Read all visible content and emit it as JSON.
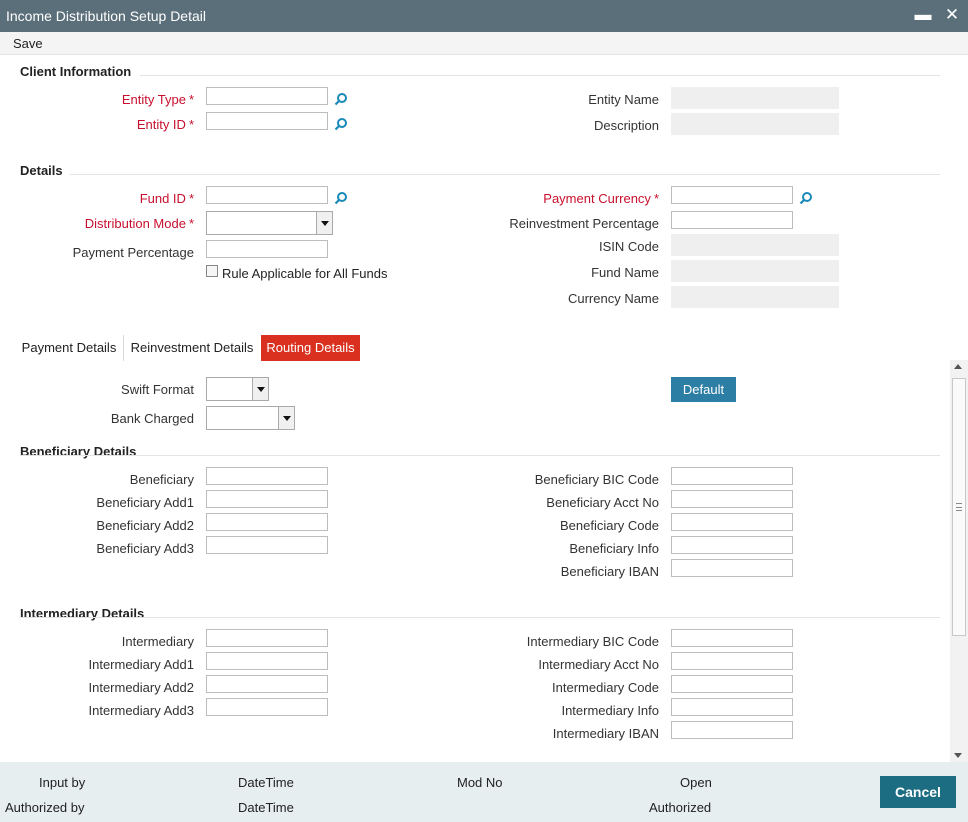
{
  "window": {
    "title": "Income Distribution Setup Detail",
    "minimize_label": "▬",
    "close_label": "✕"
  },
  "menu": {
    "save_label": "Save"
  },
  "client_info": {
    "title": "Client Information",
    "entity_type_label": "Entity Type",
    "entity_id_label": "Entity ID",
    "entity_name_label": "Entity Name",
    "description_label": "Description",
    "entity_type_value": "",
    "entity_id_value": "",
    "entity_name_value": "",
    "description_value": ""
  },
  "details": {
    "title": "Details",
    "fund_id_label": "Fund ID",
    "distribution_mode_label": "Distribution Mode",
    "payment_percentage_label": "Payment Percentage",
    "rule_applicable_label": "Rule Applicable for All Funds",
    "payment_currency_label": "Payment Currency",
    "reinvestment_percentage_label": "Reinvestment Percentage",
    "isin_code_label": "ISIN Code",
    "fund_name_label": "Fund Name",
    "currency_name_label": "Currency Name",
    "fund_id_value": "",
    "distribution_mode_value": "",
    "payment_percentage_value": "",
    "payment_currency_value": "",
    "reinvestment_percentage_value": "",
    "rule_applicable_checked": false
  },
  "tabs": [
    {
      "label": "Payment Details",
      "active": false
    },
    {
      "label": "Reinvestment Details",
      "active": false
    },
    {
      "label": "Routing Details",
      "active": true
    }
  ],
  "routing": {
    "swift_format_label": "Swift Format",
    "bank_charged_label": "Bank Charged",
    "swift_format_value": "",
    "bank_charged_value": "",
    "default_button": "Default"
  },
  "beneficiary": {
    "title": "Beneficiary Details",
    "left": [
      "Beneficiary",
      "Beneficiary Add1",
      "Beneficiary Add2",
      "Beneficiary Add3"
    ],
    "right": [
      "Beneficiary BIC Code",
      "Beneficiary Acct No",
      "Beneficiary Code",
      "Beneficiary Info",
      "Beneficiary IBAN"
    ]
  },
  "intermediary": {
    "title": "Intermediary Details",
    "left": [
      "Intermediary",
      "Intermediary Add1",
      "Intermediary Add2",
      "Intermediary Add3"
    ],
    "right": [
      "Intermediary BIC Code",
      "Intermediary Acct No",
      "Intermediary Code",
      "Intermediary Info",
      "Intermediary IBAN"
    ]
  },
  "footer": {
    "input_by": "Input by",
    "datetime_1": "DateTime",
    "mod_no": "Mod No",
    "open": "Open",
    "authorized_by": "Authorized by",
    "datetime_2": "DateTime",
    "authorized": "Authorized",
    "cancel_label": "Cancel"
  },
  "colors": {
    "titlebar": "#5b6f7a",
    "required_label": "#c8102e",
    "active_tab": "#d9301f",
    "default_button": "#2d7ea5",
    "cancel_button": "#1d6d82",
    "footer_bg": "#e6eef0"
  },
  "icons": {
    "search": "search-icon",
    "dropdown": "chevron-down-icon",
    "scroll_up": "arrow-up-icon",
    "scroll_down": "arrow-down-icon"
  }
}
